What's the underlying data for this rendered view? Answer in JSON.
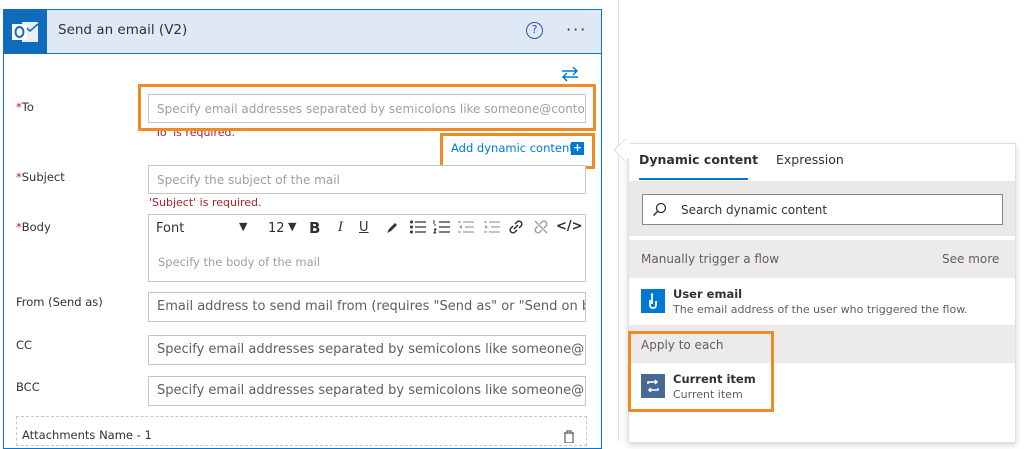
{
  "card": {
    "title": "Send an email (V2)",
    "help_glyph": "?",
    "more_glyph": "···"
  },
  "fields": {
    "to": {
      "star": "*",
      "label": "To",
      "placeholder": "Specify email addresses separated by semicolons like someone@contoso.com",
      "error": "'To' is required."
    },
    "subject": {
      "star": "*",
      "label": "Subject",
      "placeholder": "Specify the subject of the mail",
      "error": "'Subject' is required."
    },
    "body": {
      "star": "*",
      "label": "Body",
      "placeholder": "Specify the body of the mail",
      "font": "Font",
      "size": "12"
    },
    "from": {
      "label": "From (Send as)",
      "placeholder": "Email address to send mail from (requires \"Send as\" or \"Send on behalf of\" permission)"
    },
    "cc": {
      "label": "CC",
      "placeholder": "Specify email addresses separated by semicolons like someone@contoso.com"
    },
    "bcc": {
      "label": "BCC",
      "placeholder": "Specify email addresses separated by semicolons like someone@contoso.com"
    },
    "attachments": {
      "label": "Attachments Name - 1"
    }
  },
  "add_dynamic_content": "Add dynamic content",
  "toolbar": {
    "bold": "B",
    "italic": "I",
    "underline": "U",
    "code": "</>"
  },
  "dynamic_panel": {
    "tabs": [
      "Dynamic content",
      "Expression"
    ],
    "search_placeholder": "Search dynamic content",
    "sections": [
      {
        "title": "Manually trigger a flow",
        "see_more": "See more",
        "items": [
          {
            "name": "User email",
            "description": "The email address of the user who triggered the flow."
          }
        ]
      },
      {
        "title": "Apply to each",
        "items": [
          {
            "name": "Current item",
            "description": "Current item"
          }
        ]
      }
    ]
  },
  "colors": {
    "accent": "#0078d4",
    "highlight": "#f08a24",
    "error": "#a4262c"
  }
}
